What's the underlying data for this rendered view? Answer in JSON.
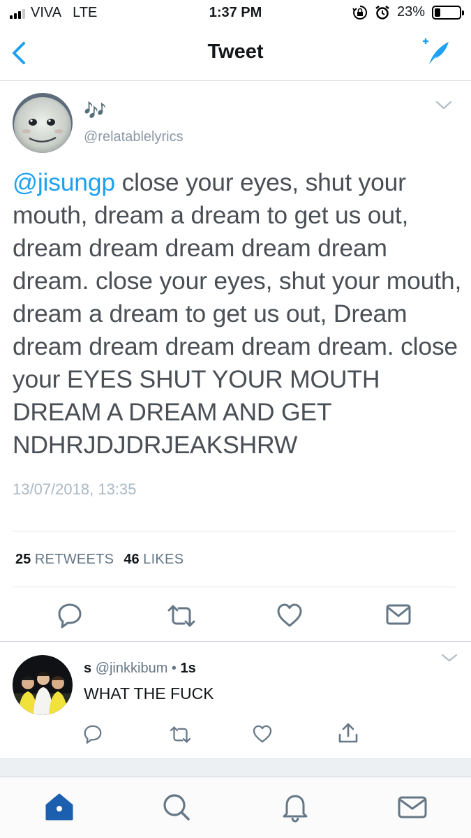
{
  "status_bar": {
    "carrier": "VIVA",
    "network": "LTE",
    "time": "1:37 PM",
    "battery_percent": "23%",
    "battery_level": 0.23
  },
  "nav": {
    "title": "Tweet",
    "back_icon": "chevron-left-icon",
    "compose_icon": "compose-feather-icon"
  },
  "tweet": {
    "display_name": "🎶",
    "handle": "@relatablelyrics",
    "mention": "@jisungp",
    "text": " close your eyes, shut your mouth, dream a dream to get us out, dream dream dream dream dream dream. close your eyes, shut your mouth, dream a dream to get us out, Dream dream dream dream dream dream. close your EYES SHUT YOUR MOUTH DREAM A DREAM AND GET NDHRJDJDRJEAKSHRW",
    "timestamp": "13/07/2018, 13:35",
    "retweets_count": "25",
    "retweets_label": "RETWEETS",
    "likes_count": "46",
    "likes_label": "LIKES"
  },
  "reply": {
    "name": "s",
    "handle": "@jinkkibum",
    "separator": "•",
    "time": "1s",
    "text": "WHAT THE FUCK"
  },
  "colors": {
    "accent": "#1da1f2",
    "tab_active": "#1b5fae",
    "text_secondary": "#657786"
  }
}
